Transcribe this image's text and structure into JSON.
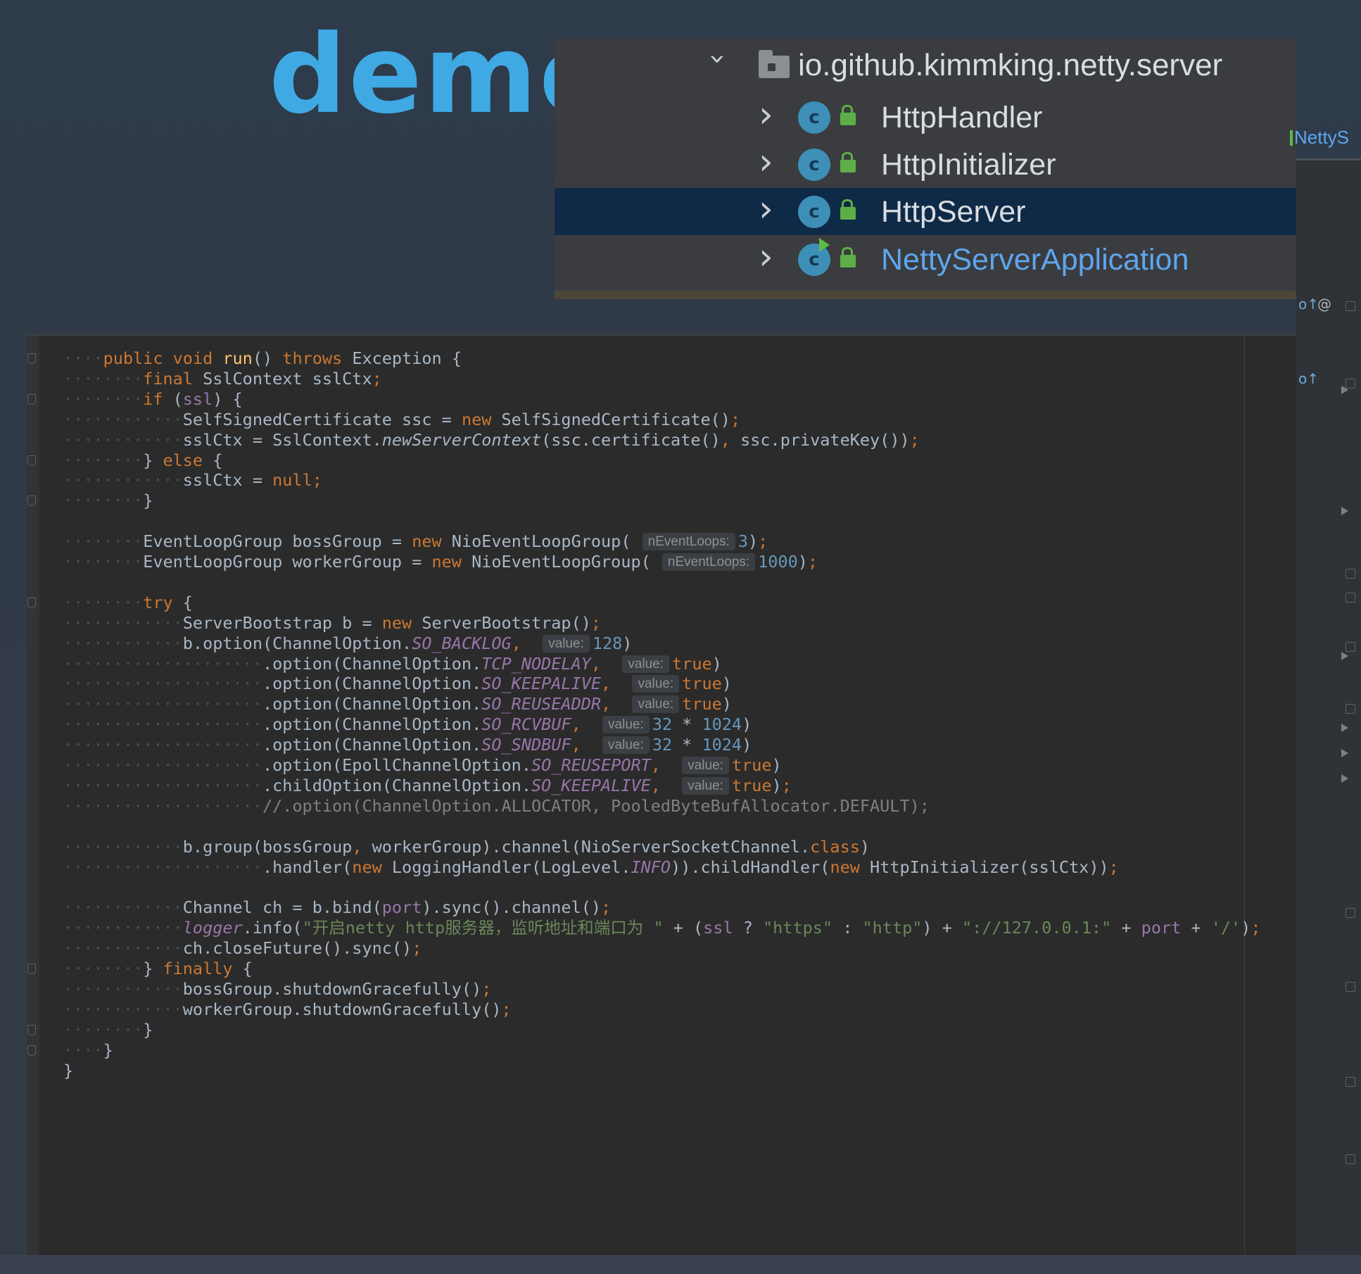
{
  "header": {
    "title": "demo"
  },
  "project_tree": {
    "package": "io.github.kimmking.netty.server",
    "classes": [
      {
        "name": "HttpHandler",
        "icon": "class-icon",
        "selected": false
      },
      {
        "name": "HttpInitializer",
        "icon": "class-icon",
        "selected": false
      },
      {
        "name": "HttpServer",
        "icon": "class-icon",
        "selected": true
      },
      {
        "name": "NettyServerApplication",
        "icon": "runnable-class-icon",
        "selected": false
      }
    ]
  },
  "side_tab": {
    "label": "NettyS"
  },
  "colors": {
    "title": "#3fa9e4",
    "selection": "#0f2a46",
    "keyword": "#cc7832",
    "method": "#ffc66d",
    "number": "#6897bb",
    "string": "#6a8759",
    "constant": "#9876aa",
    "editor_background": "#2b2b2b"
  },
  "code": {
    "lines": [
      "    public void run() throws Exception {",
      "        final SslContext sslCtx;",
      "        if (ssl) {",
      "            SelfSignedCertificate ssc = new SelfSignedCertificate();",
      "            sslCtx = SslContext.newServerContext(ssc.certificate(), ssc.privateKey());",
      "        } else {",
      "            sslCtx = null;",
      "        }",
      "",
      "        EventLoopGroup bossGroup = new NioEventLoopGroup( nEventLoops: 3);",
      "        EventLoopGroup workerGroup = new NioEventLoopGroup( nEventLoops: 1000);",
      "",
      "        try {",
      "            ServerBootstrap b = new ServerBootstrap();",
      "            b.option(ChannelOption.SO_BACKLOG,  value: 128)",
      "                    .option(ChannelOption.TCP_NODELAY,  value: true)",
      "                    .option(ChannelOption.SO_KEEPALIVE,  value: true)",
      "                    .option(ChannelOption.SO_REUSEADDR,  value: true)",
      "                    .option(ChannelOption.SO_RCVBUF,  value: 32 * 1024)",
      "                    .option(ChannelOption.SO_SNDBUF,  value: 32 * 1024)",
      "                    .option(EpollChannelOption.SO_REUSEPORT,  value: true)",
      "                    .childOption(ChannelOption.SO_KEEPALIVE,  value: true);",
      "                    //.option(ChannelOption.ALLOCATOR, PooledByteBufAllocator.DEFAULT);",
      "",
      "            b.group(bossGroup, workerGroup).channel(NioServerSocketChannel.class)",
      "                    .handler(new LoggingHandler(LogLevel.INFO)).childHandler(new HttpInitializer(sslCtx));",
      "",
      "            Channel ch = b.bind(port).sync().channel();",
      "            logger.info(\"开启netty http服务器，监听地址和端口为 \" + (ssl ? \"https\" : \"http\") + \"://127.0.0.1:\" + port + '/');",
      "            ch.closeFuture().sync();",
      "        } finally {",
      "            bossGroup.shutdownGracefully();",
      "            workerGroup.shutdownGracefully();",
      "        }",
      "    }",
      "}"
    ]
  }
}
